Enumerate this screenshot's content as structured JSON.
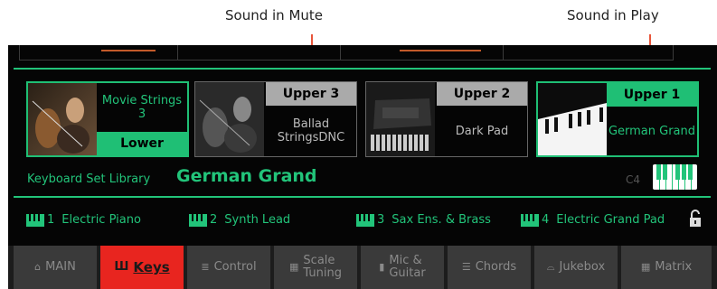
{
  "callouts": {
    "mute_label": "Sound in Mute",
    "play_label": "Sound in Play"
  },
  "sounds": [
    {
      "id": "lower",
      "tag": "Lower",
      "name": "Movie Strings 3",
      "state": "active"
    },
    {
      "id": "upper3",
      "tag": "Upper 3",
      "name": "Ballad StringsDNC",
      "state": "muted"
    },
    {
      "id": "upper2",
      "tag": "Upper 2",
      "name": "Dark Pad",
      "state": "muted"
    },
    {
      "id": "upper1",
      "tag": "Upper 1",
      "name": "German Grand",
      "state": "active"
    }
  ],
  "library": {
    "label": "Keyboard Set Library",
    "current_name": "German Grand",
    "octave": "C4"
  },
  "keyboard_sets": [
    {
      "num": "1",
      "name": "Electric Piano"
    },
    {
      "num": "2",
      "name": "Synth Lead"
    },
    {
      "num": "3",
      "name": "Sax Ens. & Brass"
    },
    {
      "num": "4",
      "name": "Electric Grand Pad"
    }
  ],
  "tabs": [
    {
      "label": "MAIN",
      "icon": "home-icon",
      "active": false
    },
    {
      "label": "Keys",
      "icon": "keyboard-icon",
      "active": true
    },
    {
      "label": "Control",
      "icon": "sliders-icon",
      "active": false
    },
    {
      "label": "Scale\nTuning",
      "icon": "scale-icon",
      "active": false
    },
    {
      "label": "Mic &\nGuitar",
      "icon": "mic-icon",
      "active": false
    },
    {
      "label": "Chords",
      "icon": "chords-icon",
      "active": false
    },
    {
      "label": "Jukebox",
      "icon": "jukebox-icon",
      "active": false
    },
    {
      "label": "Matrix",
      "icon": "grid-icon",
      "active": false
    }
  ],
  "colors": {
    "accent_green": "#22c47a",
    "active_tab_red": "#e8251f",
    "callout_line": "#e8553a"
  }
}
